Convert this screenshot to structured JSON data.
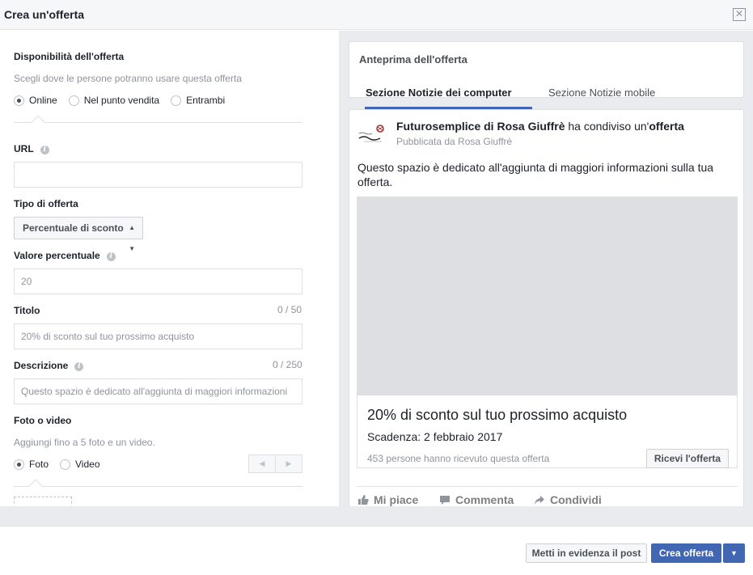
{
  "dialog": {
    "title": "Crea un'offerta",
    "close_icon": "close-icon"
  },
  "form": {
    "availability": {
      "label": "Disponibilità dell'offerta",
      "hint": "Scegli dove le persone potranno usare questa offerta",
      "options": [
        "Online",
        "Nel punto vendita",
        "Entrambi"
      ],
      "selected": "Online"
    },
    "url": {
      "label": "URL",
      "value": ""
    },
    "offer_type": {
      "label": "Tipo di offerta",
      "selected": "Percentuale di sconto"
    },
    "percent_value": {
      "label": "Valore percentuale",
      "placeholder": "20"
    },
    "title": {
      "label": "Titolo",
      "counter": "0 / 50",
      "placeholder": "20% di sconto sul tuo prossimo acquisto"
    },
    "description": {
      "label": "Descrizione",
      "counter": "0 / 250",
      "placeholder": "Questo spazio è dedicato all'aggiunta di maggiori informazioni"
    },
    "media": {
      "label": "Foto o video",
      "hint": "Aggiungi fino a 5 foto e un video.",
      "options": [
        "Foto",
        "Video"
      ],
      "selected": "Foto"
    }
  },
  "preview": {
    "title": "Anteprima dell'offerta",
    "tabs": [
      "Sezione Notizie dei computer",
      "Sezione Notizie mobile"
    ],
    "active_tab": "Sezione Notizie dei computer",
    "post": {
      "page_name": "Futurosemplice di Rosa Giuffrè",
      "shared_text": " ha condiviso un'",
      "shared_object": "offerta",
      "published_by": "Pubblicata da Rosa Giuffrè",
      "body": "Questo spazio è dedicato all'aggiunta di maggiori informazioni sulla tua offerta.",
      "offer_title": "20% di sconto sul tuo prossimo acquisto",
      "expiry": "Scadenza: 2 febbraio 2017",
      "stats": "453 persone hanno ricevuto questa offerta",
      "get_offer_button": "Ricevi l'offerta",
      "actions": [
        "Mi piace",
        "Commenta",
        "Condividi"
      ]
    }
  },
  "footer": {
    "boost_button": "Metti in evidenza il post",
    "create_button": "Crea offerta"
  },
  "colors": {
    "accent": "#4267b2",
    "background": "#e9ebee"
  }
}
